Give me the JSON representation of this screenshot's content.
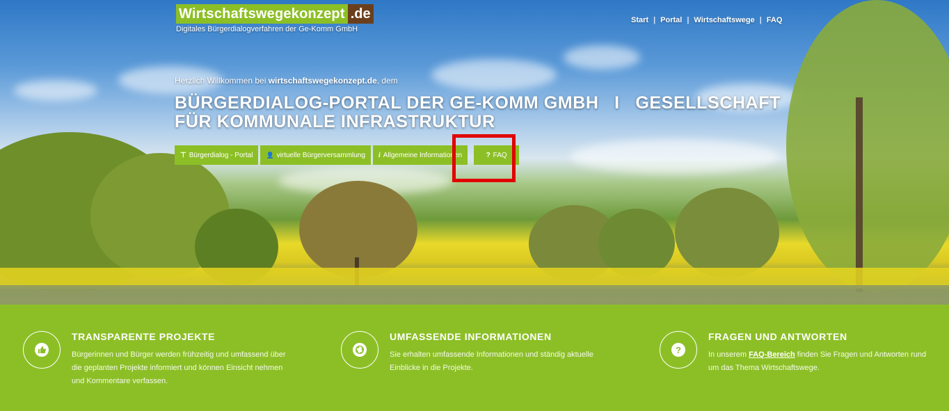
{
  "logo": {
    "main": "Wirtschaftswegekonzept",
    "tld": ".de",
    "sub": "Digitales Bürgerdialogverfahren der Ge-Komm GmbH"
  },
  "nav": {
    "items": [
      "Start",
      "Portal",
      "Wirtschaftswege",
      "FAQ"
    ],
    "separator": "|"
  },
  "hero": {
    "welcome_prefix": "Herzlich Willkommen bei ",
    "welcome_site": "wirtschaftswegekonzept.de",
    "welcome_suffix": ", dem",
    "headline_line1": "BÜRGERDIALOG-PORTAL DER GE-KOMM GMBH   I   GESELLSCHAFT",
    "headline_line2": "FÜR KOMMUNALE INFRASTRUKTUR"
  },
  "buttons": [
    {
      "icon": "signpost-icon",
      "glyph": "⊤",
      "label": "Bürgerdialog - Portal"
    },
    {
      "icon": "user-plus-icon",
      "glyph": "👤",
      "label": "virtuelle Bürgerversammlung"
    },
    {
      "icon": "info-icon",
      "glyph": "i",
      "label": "Allgemeine Informationen"
    },
    {
      "icon": "question-icon",
      "glyph": "?",
      "label": "FAQ"
    }
  ],
  "features": [
    {
      "icon": "thumbs-up-icon",
      "glyph": "👍",
      "title": "TRANSPARENTE PROJEKTE",
      "text": "Bürgerinnen und Bürger werden frühzeitig und umfassend über die geplanten Projekte informiert und können Einsicht nehmen und Kommentare verfassen."
    },
    {
      "icon": "globe-icon",
      "glyph": "🌐",
      "title": "UMFASSENDE INFORMATIONEN",
      "text": "Sie erhalten umfassende Informationen und ständig aktuelle Einblicke in die Projekte."
    },
    {
      "icon": "question-circle-icon",
      "glyph": "?",
      "title": "FRAGEN UND ANTWORTEN",
      "text_prefix": "In unserem ",
      "link": "FAQ-Bereich",
      "text_suffix": " finden Sie Fragen und Antworten rund um das Thema Wirtschaftswege."
    }
  ],
  "colors": {
    "brand_green": "#8cbf26",
    "brand_brown": "#6b3f1d",
    "highlight_red": "#e10000"
  }
}
